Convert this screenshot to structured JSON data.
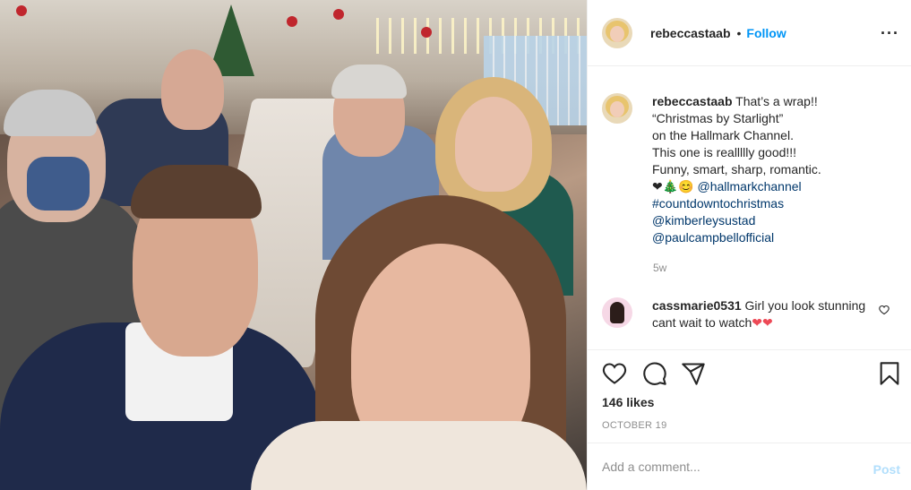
{
  "post": {
    "image_alt": "Selfie of cast at a diner counter decorated for Christmas"
  },
  "header": {
    "username": "rebeccastaab",
    "separator": "•",
    "follow_label": "Follow",
    "more_icon": "more-horizontal-icon"
  },
  "caption": {
    "username": "rebeccastaab",
    "text": "That’s a wrap!!\n“Christmas by Starlight”\non the Hallmark Channel.\nThis one is reallllly good!!!\nFunny, smart, sharp, romantic.",
    "emoji": "❤🎄😊",
    "mention_1": "@hallmarkchannel",
    "hashtag": "#countdowntochristmas",
    "mention_2": "@kimberleysustad",
    "mention_3": "@paulcampbellofficial",
    "time": "5w"
  },
  "comment": {
    "username": "cassmarie0531",
    "text": "Girl you look stunning cant wait to watch",
    "emoji": "❤❤"
  },
  "actions": {
    "like_icon": "heart-icon",
    "comment_icon": "comment-icon",
    "share_icon": "share-icon",
    "save_icon": "bookmark-icon"
  },
  "likes": "146 likes",
  "date": "OCTOBER 19",
  "comment_input": {
    "placeholder": "Add a comment...",
    "post_label": "Post"
  },
  "colors": {
    "follow": "#0095f6",
    "post_disabled": "#b2dffc",
    "link": "#00376b",
    "heart": "#ed4956"
  }
}
